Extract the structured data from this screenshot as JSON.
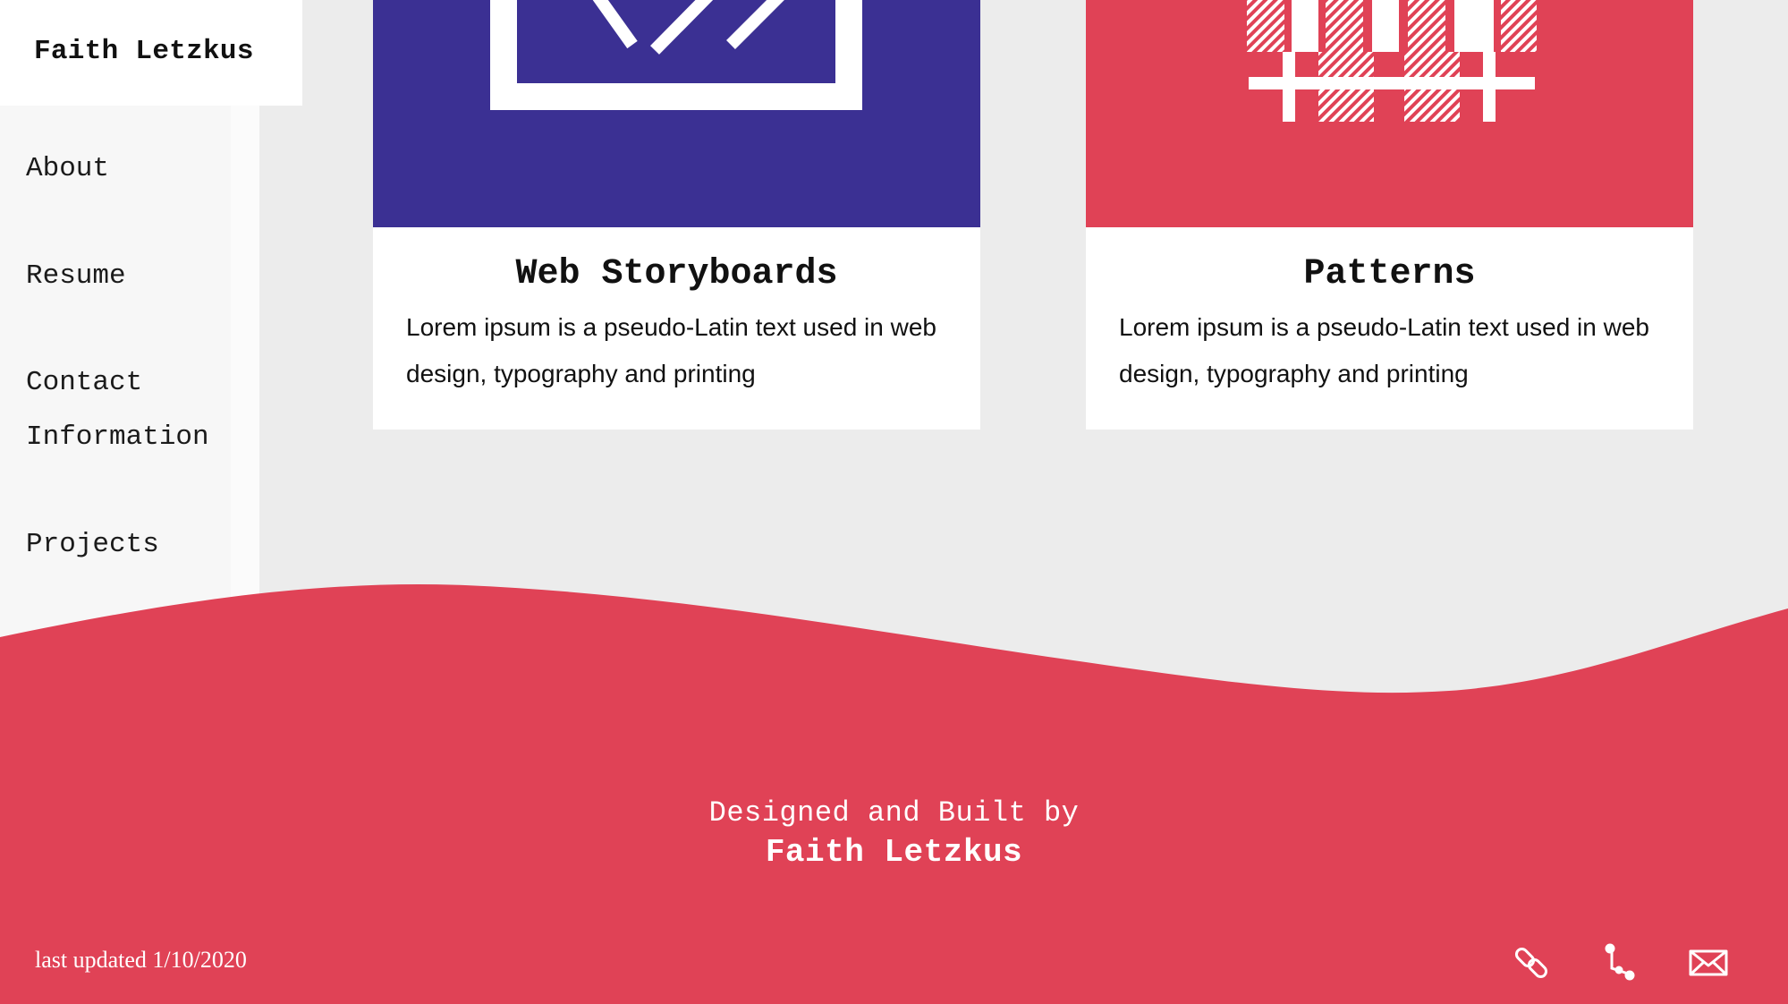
{
  "brand": {
    "name": "Faith Letzkus"
  },
  "sidebar": {
    "items": [
      {
        "label": "About"
      },
      {
        "label": "Resume"
      },
      {
        "label": "Contact\nInformation"
      },
      {
        "label": "Projects"
      }
    ]
  },
  "cards": [
    {
      "title": "Web Storyboards",
      "description": "Lorem ipsum is a pseudo-Latin text used in web design, typography and printing",
      "image_icon": "code-brackets-icon",
      "image_color": "#3b3093"
    },
    {
      "title": "Patterns",
      "description": "Lorem ipsum is a pseudo-Latin text used in web design, typography and printing",
      "image_icon": "plaid-pattern-icon",
      "image_color": "#e04256"
    }
  ],
  "footer": {
    "line1": "Designed and Built by",
    "line2": "Faith Letzkus",
    "last_updated": "last updated 1/10/2020",
    "icons": [
      "link-icon",
      "git-branch-icon",
      "mail-icon"
    ],
    "color": "#e04256"
  },
  "colors": {
    "background": "#ececec",
    "accent": "#e04256",
    "card_blue": "#3b3093"
  }
}
